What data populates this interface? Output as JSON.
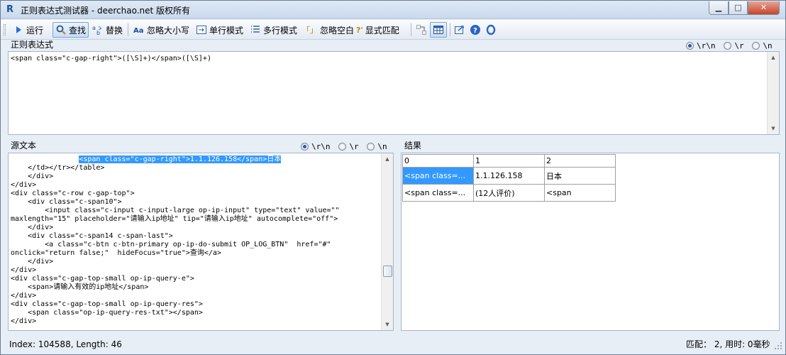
{
  "window": {
    "title": "正则表达式测试器 - deerchao.net 版权所有",
    "app_icon_letter": "R",
    "min_glyph": "▁",
    "max_glyph": "□",
    "close_glyph": "✕"
  },
  "toolbar": {
    "run": "运行",
    "find": "查找",
    "replace": "替换",
    "ignore_case": "忽略大小写",
    "single_line": "单行模式",
    "multi_line": "多行模式",
    "ignore_whitespace": "忽略空白",
    "explicit_capture": "显式匹配",
    "ignore_ws_glyph": "「」",
    "explicit_glyph": "?'"
  },
  "regex": {
    "label": "正则表达式",
    "value": "<span class=\"c-gap-right\">([\\S]+)</span>([\\S]+)",
    "newline_options": [
      "\\r\\n",
      "\\r",
      "\\n"
    ],
    "selected_newline": "\\r\\n"
  },
  "source": {
    "label": "源文本",
    "newline_options": [
      "\\r\\n",
      "\\r",
      "\\n"
    ],
    "selected_newline": "\\r\\n",
    "indent_before_highlight": "                ",
    "highlighted": "<span class=\"c-gap-right\">1.1.126.158</span>日本",
    "lines": [
      "    </td></tr></table>",
      "    </div>",
      "</div>",
      "<div class=\"c-row c-gap-top\">",
      "    <div class=\"c-span10\">",
      "        <input class=\"c-input c-input-large op-ip-input\" type=\"text\" value=\"\"",
      "maxlength=\"15\" placeholder=\"请输入ip地址\" tip=\"请输入ip地址\" autocomplete=\"off\">",
      "    </div>",
      "    <div class=\"c-span14 c-span-last\">",
      "        <a class=\"c-btn c-btn-primary op-ip-do-submit OP_LOG_BTN\"  href=\"#\"",
      "onclick=\"return false;\"  hideFocus=\"true\">查询</a>",
      "    </div>",
      "</div>",
      "<div class=\"c-gap-top-small op-ip-query-e\">",
      "    <span>请输入有效的ip地址</span>",
      "</div>",
      "<div class=\"c-gap-top-small op-ip-query-res\">",
      "    <span class=\"op-ip-query-res-txt\"></span>",
      "</div>"
    ]
  },
  "results": {
    "label": "结果",
    "headers": [
      "0",
      "1",
      "2"
    ],
    "rows": [
      [
        "<span class=...",
        "1.1.126.158",
        "日本"
      ],
      [
        "<span class=...",
        "(12人评价)",
        "<span"
      ]
    ]
  },
  "status": {
    "index_length": "Index: 104588, Length: 46",
    "summary": "匹配： 2, 用时: 0毫秒"
  },
  "colors": {
    "selection": "#3399ff",
    "frame": "#e8eef6"
  }
}
